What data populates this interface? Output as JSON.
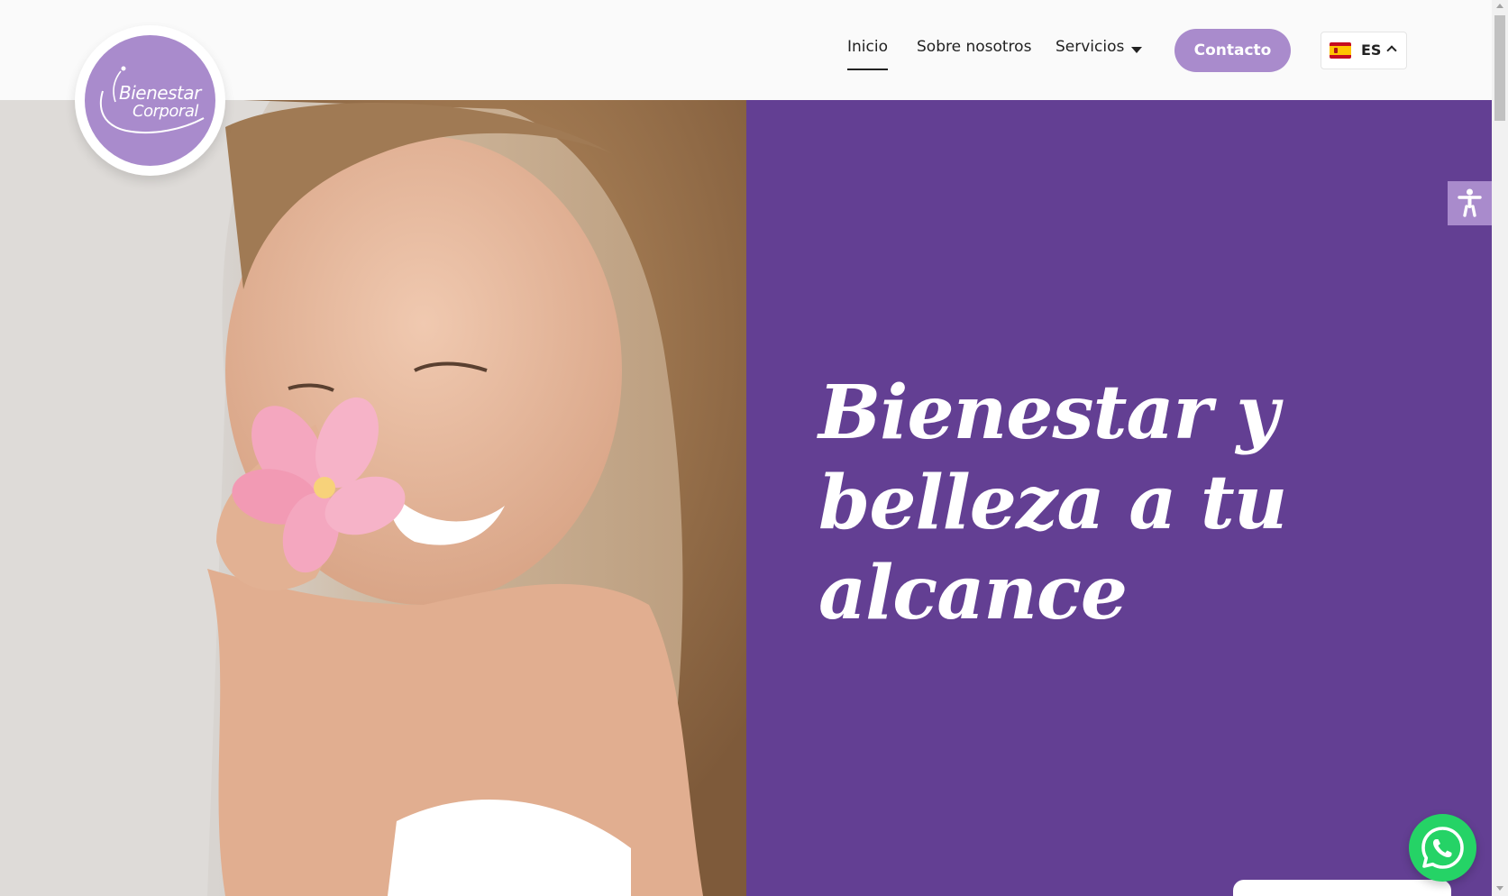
{
  "header": {
    "logo": {
      "line1": "Bienestar",
      "line2": "Corporal",
      "color": "#a98bcc"
    },
    "nav": [
      {
        "label": "Inicio",
        "active": true
      },
      {
        "label": "Sobre nosotros",
        "active": false
      },
      {
        "label": "Servicios",
        "active": false,
        "has_dropdown": true
      }
    ],
    "cta_label": "Contacto",
    "language": {
      "code": "ES",
      "flag": "spain-flag-icon"
    }
  },
  "hero": {
    "title": "Bienestar y belleza a tu alcance",
    "image": "woman-holding-pink-flower",
    "panel_color": "#633f93"
  },
  "widgets": {
    "accessibility": "accessibility-icon",
    "whatsapp": "whatsapp-icon"
  },
  "colors": {
    "accent": "#a98bcc",
    "primary": "#633f93",
    "whatsapp": "#25d366"
  }
}
